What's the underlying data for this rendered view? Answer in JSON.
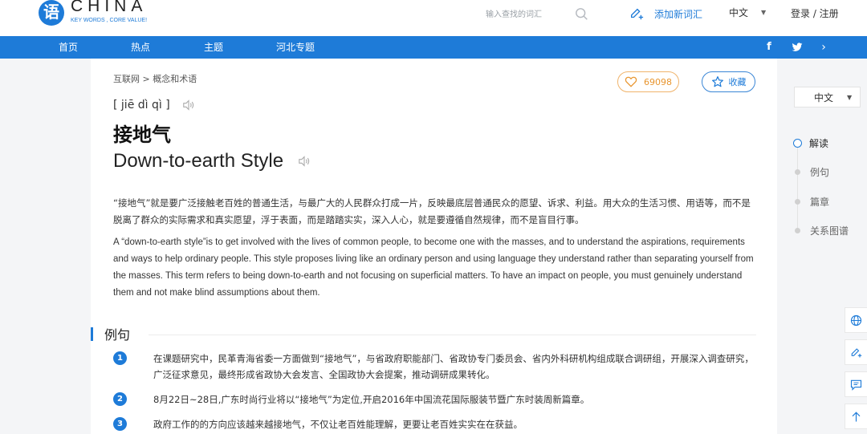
{
  "header": {
    "logo_glyph": "语",
    "logo_word": "CHINA",
    "logo_tagline": "KEY WORDS , CORE VALUE!",
    "search_placeholder": "输入查找的词汇",
    "add_word_label": "添加新词汇",
    "language": "中文",
    "login_label": "登录 / 注册"
  },
  "nav": {
    "items": [
      "首页",
      "热点",
      "主题",
      "河北专题"
    ],
    "social": [
      "facebook-icon",
      "twitter-icon",
      "chevron-right-icon"
    ]
  },
  "entry": {
    "breadcrumb": "互联网 > 概念和术语",
    "like_count": "69098",
    "favorite_label": "收藏",
    "pinyin": "[ jiē dì qì ]",
    "term_cn": "接地气",
    "term_en": "Down-to-earth Style",
    "definition_cn": "“接地气”就是要广泛接触老百姓的普通生活，与最广大的人民群众打成一片，反映最底层普通民众的愿望、诉求、利益。用大众的生活习惯、用语等，而不是脱离了群众的实际需求和真实愿望，浮于表面，而是踏踏实实，深入人心，就是要遵循自然规律，而不是盲目行事。",
    "definition_en": "A “down-to-earth style”is to get involved with the lives of common people, to become one with the masses, and to understand the aspirations, requirements and ways to help ordinary people. This style proposes living like an ordinary person and using language they understand rather than separating yourself from the masses. This term refers to being down-to-earth and not focusing on superficial matters. To have an impact on people, you must genuinely understand them and not make blind assumptions about them."
  },
  "examples": {
    "title": "例句",
    "items": [
      {
        "num": "1",
        "text": "在课题研究中，民革青海省委一方面做到“接地气”，与省政府职能部门、省政协专门委员会、省内外科研机构组成联合调研组，开展深入调查研究，广泛征求意见，最终形成省政协大会发言、全国政协大会提案，推动调研成果转化。"
      },
      {
        "num": "2",
        "text": "8月22日~28日,广东时尚行业将以“接地气”为定位,开启2016年中国流花国际服装节暨广东时装周新篇章。"
      },
      {
        "num": "3",
        "text": "政府工作的的方向应该越来越接地气，不仅让老百姓能理解，更要让老百姓实实在在获益。"
      }
    ]
  },
  "sidebar": {
    "language": "中文",
    "toc": [
      "解读",
      "例句",
      "篇章",
      "关系图谱"
    ],
    "tools": [
      "globe-icon",
      "edit-icon",
      "message-icon",
      "arrow-up-icon"
    ]
  },
  "colors": {
    "brand_blue": "#1e7bd8",
    "like_orange": "#e8952e"
  }
}
